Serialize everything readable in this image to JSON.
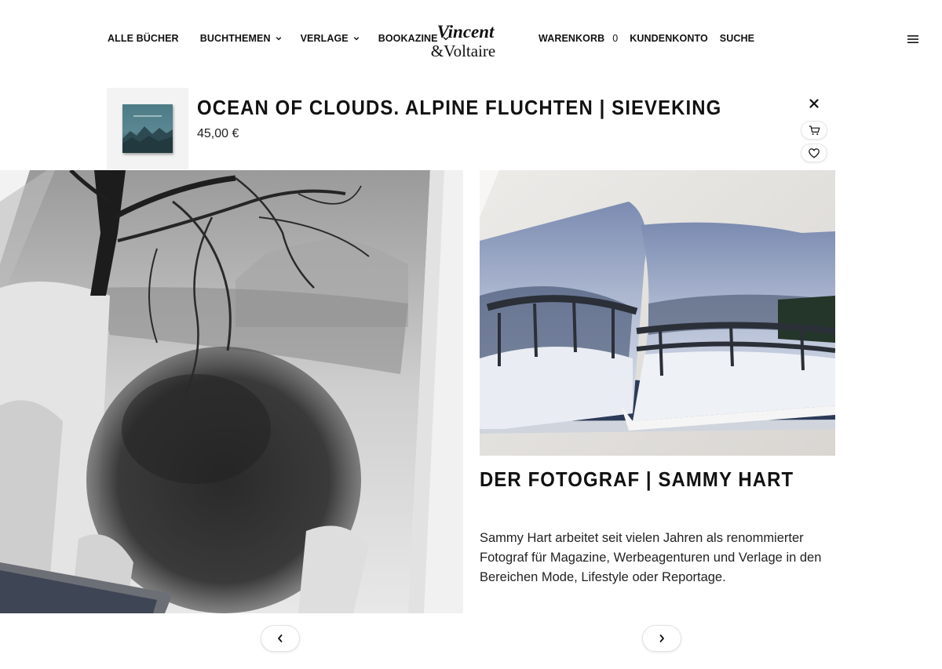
{
  "nav": {
    "left": [
      {
        "label": "ALLE BÜCHER",
        "dropdown": false
      },
      {
        "label": "BUCHTHEMEN",
        "dropdown": true
      },
      {
        "label": "VERLAGE",
        "dropdown": true
      },
      {
        "label": "BOOKAZINE",
        "dropdown": true
      }
    ],
    "logo": {
      "line1": "Vincent",
      "line2": "&Voltaire"
    },
    "right": {
      "cart_label": "WARENKORB",
      "cart_count": "0",
      "account_label": "KUNDENKONTO",
      "search_label": "SUCHE"
    },
    "menu_icon": "hamburger-icon"
  },
  "product": {
    "title": "OCEAN OF CLOUDS. ALPINE FLUCHTEN | SIEVEKING",
    "price": "45,00 €",
    "icons": {
      "close": "close-icon",
      "cart": "cart-icon",
      "wishlist": "heart-icon"
    }
  },
  "content": {
    "heading": "DER FOTOGRAF | SAMMY HART",
    "body": "Sammy Hart arbeitet seit vielen Jahren als renommierter Fotograf für Magazine, Werbeagenturen und Verlage in den Bereichen Mode, Lifestyle oder Reportage."
  },
  "pager": {
    "prev_icon": "chevron-left-icon",
    "next_icon": "chevron-right-icon"
  },
  "colors": {
    "text": "#111111",
    "border": "#e3e3e3",
    "thumb_bg": "#f3f3f3",
    "book_cover": "#3f6a73"
  }
}
